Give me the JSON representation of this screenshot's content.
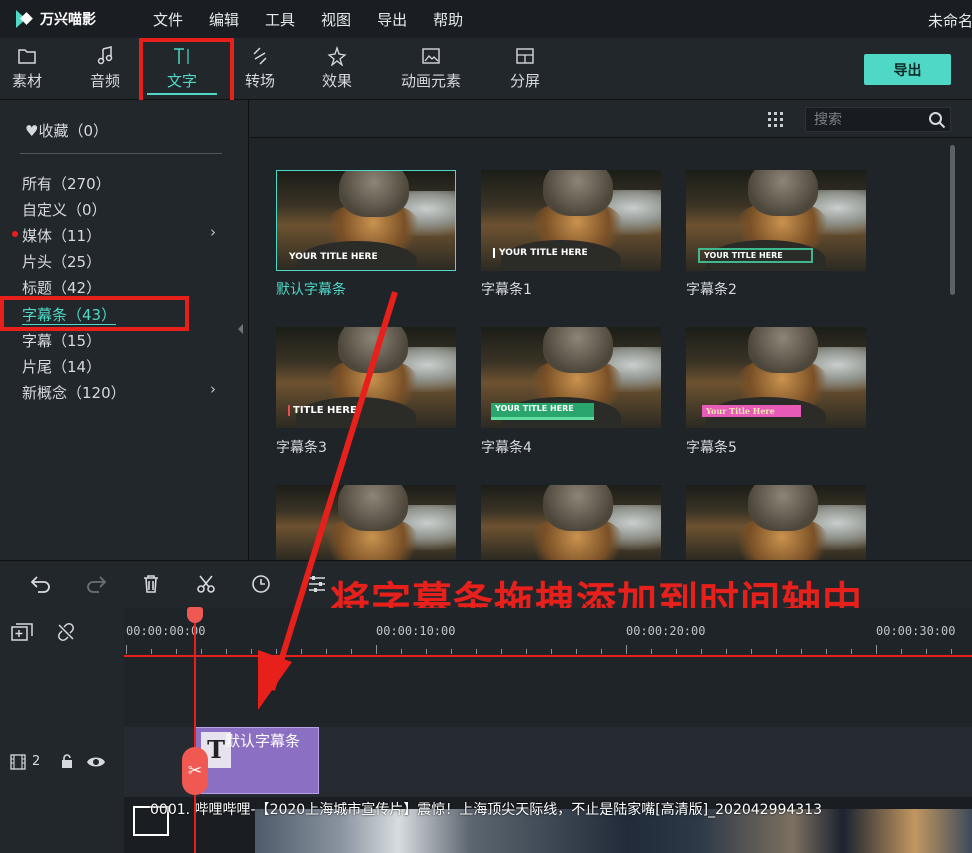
{
  "app": {
    "name": "万兴喵影",
    "project_title": "未命名:"
  },
  "menu": [
    "文件",
    "编辑",
    "工具",
    "视图",
    "导出",
    "帮助"
  ],
  "tabs": [
    {
      "label": "素材",
      "icon": "folder-icon"
    },
    {
      "label": "音频",
      "icon": "music-note-icon"
    },
    {
      "label": "文字",
      "icon": "text-cursor-icon",
      "active": true
    },
    {
      "label": "转场",
      "icon": "transition-icon"
    },
    {
      "label": "效果",
      "icon": "effects-sparkle-icon"
    },
    {
      "label": "动画元素",
      "icon": "image-element-icon"
    },
    {
      "label": "分屏",
      "icon": "split-screen-icon"
    }
  ],
  "export_label": "导出",
  "sidebar": {
    "favorites": "收藏（0）",
    "categories": [
      {
        "label": "所有（270）"
      },
      {
        "label": "自定义（0）"
      },
      {
        "label": "媒体（11）",
        "dot": true,
        "chevron": true
      },
      {
        "label": "片头（25）"
      },
      {
        "label": "标题（42）"
      },
      {
        "label": "字幕条（43）",
        "selected": true
      },
      {
        "label": "字幕（15）"
      },
      {
        "label": "片尾（14）"
      },
      {
        "label": "新概念（120）",
        "chevron": true
      }
    ]
  },
  "search": {
    "placeholder": "搜索"
  },
  "templates": [
    {
      "label": "默认字幕条",
      "caption": "YOUR TITLE HERE",
      "selected": true
    },
    {
      "label": "字幕条1",
      "caption": "YOUR TITLE HERE"
    },
    {
      "label": "字幕条2",
      "caption": "YOUR TITLE HERE"
    },
    {
      "label": "字幕条3",
      "caption": "TITLE HERE"
    },
    {
      "label": "字幕条4",
      "caption": "YOUR TITLE HERE"
    },
    {
      "label": "字幕条5",
      "caption": "Your Title Here"
    },
    {
      "label": "",
      "caption": ""
    },
    {
      "label": "",
      "caption": ""
    },
    {
      "label": "",
      "caption": ""
    }
  ],
  "annotation": "将字幕条拖拽添加到时间轴中",
  "timeline": {
    "ruler_labels": [
      "00:00:00:00",
      "00:00:10:00",
      "00:00:20:00",
      "00:00:30:00"
    ],
    "track2_label": "2",
    "title_clip": "默认字幕条",
    "video_clip": "0001. 哔哩哔哩-【2020上海城市宣传片】震惊！上海顶尖天际线，不止是陆家嘴[高清版]_202042994313"
  },
  "colors": {
    "accent": "#4ed8c5",
    "annotation_red": "#e8201c",
    "clip_purple": "#8b6fc2"
  }
}
